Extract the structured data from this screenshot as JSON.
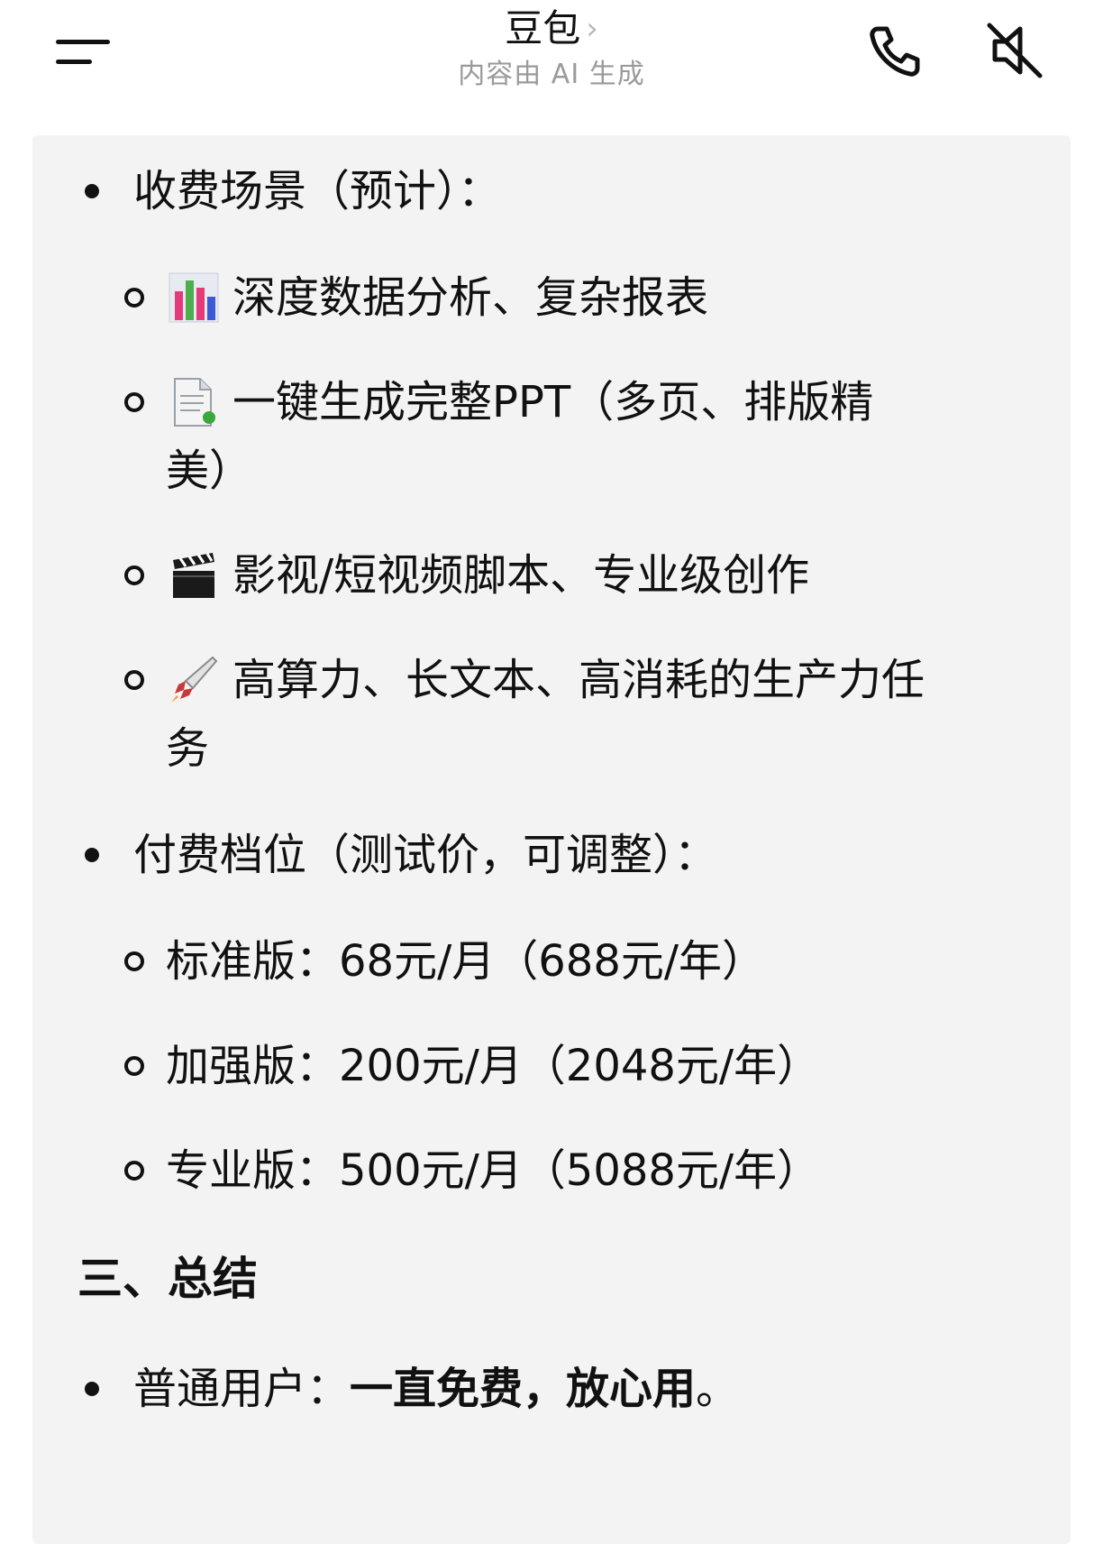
{
  "header": {
    "title": "豆包",
    "chevron": "›",
    "subtitle": "内容由 AI 生成",
    "menu_icon": "menu-icon",
    "phone_icon": "phone-icon",
    "mute_icon": "speaker-mute-icon"
  },
  "content": {
    "section1": {
      "heading": "收费场景（预计）：",
      "items": [
        {
          "emoji": "bar-chart-icon",
          "text": "深度数据分析、复杂报表"
        },
        {
          "emoji": "document-icon",
          "text_line1": "一键生成完整PPT（多页、排版精",
          "text_line2": "美）"
        },
        {
          "emoji": "clapperboard-icon",
          "text": "影视/短视频脚本、专业级创作"
        },
        {
          "emoji": "rocket-icon",
          "text_line1": "高算力、长文本、高消耗的生产力任",
          "text_line2": "务"
        }
      ]
    },
    "section2": {
      "heading": "付费档位（测试价，可调整）：",
      "tiers": [
        {
          "text": "标准版：68元/月（688元/年）"
        },
        {
          "text": "加强版：200元/月（2048元/年）"
        },
        {
          "text": "专业版：500元/月（5088元/年）"
        }
      ]
    },
    "section3": {
      "heading": "三、总结",
      "item_label": "普通用户：",
      "item_bold": "一直免费，放心用",
      "item_end": "。"
    }
  },
  "colors": {
    "card_bg": "#f3f3f3",
    "text": "#111111",
    "subtitle": "#9a9a9a"
  }
}
